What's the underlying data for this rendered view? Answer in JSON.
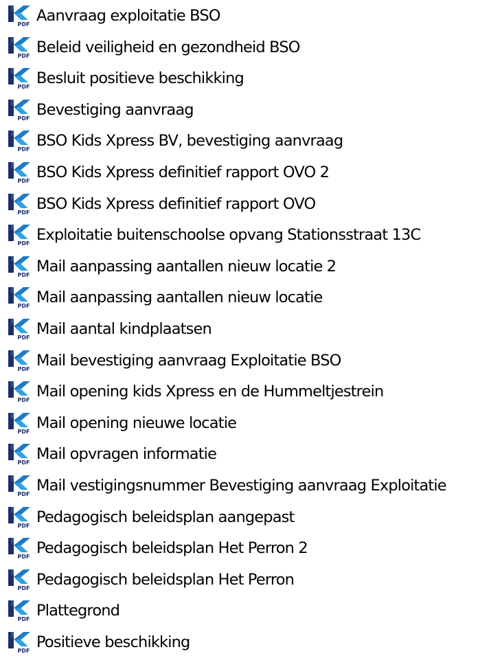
{
  "explorer": {
    "icon": "pdf-file-icon",
    "colors": {
      "icon_dark_blue": "#1a2e6a",
      "icon_blue": "#1f7ac8",
      "icon_light_blue": "#2ea2e4",
      "icon_badge_text": "#1a2e6a",
      "label_text": "#000000",
      "background": "#ffffff"
    },
    "files": [
      {
        "name": "Aanvraag exploitatie BSO"
      },
      {
        "name": "Beleid veiligheid en gezondheid BSO"
      },
      {
        "name": "Besluit positieve beschikking"
      },
      {
        "name": "Bevestiging aanvraag"
      },
      {
        "name": "BSO Kids Xpress BV, bevestiging aanvraag"
      },
      {
        "name": "BSO Kids Xpress definitief rapport OVO 2"
      },
      {
        "name": "BSO Kids Xpress definitief rapport OVO"
      },
      {
        "name": "Exploitatie buitenschoolse opvang Stationsstraat 13C"
      },
      {
        "name": "Mail aanpassing aantallen nieuw locatie 2"
      },
      {
        "name": "Mail aanpassing aantallen nieuw locatie"
      },
      {
        "name": "Mail aantal kindplaatsen"
      },
      {
        "name": "Mail bevestiging aanvraag Exploitatie BSO"
      },
      {
        "name": "Mail opening kids Xpress en de Hummeltjestrein"
      },
      {
        "name": "Mail opening nieuwe locatie"
      },
      {
        "name": "Mail opvragen informatie"
      },
      {
        "name": "Mail vestigingsnummer Bevestiging aanvraag Exploitatie"
      },
      {
        "name": "Pedagogisch beleidsplan aangepast"
      },
      {
        "name": "Pedagogisch beleidsplan Het Perron 2"
      },
      {
        "name": "Pedagogisch beleidsplan Het Perron"
      },
      {
        "name": "Plattegrond"
      },
      {
        "name": "Positieve beschikking"
      }
    ]
  }
}
